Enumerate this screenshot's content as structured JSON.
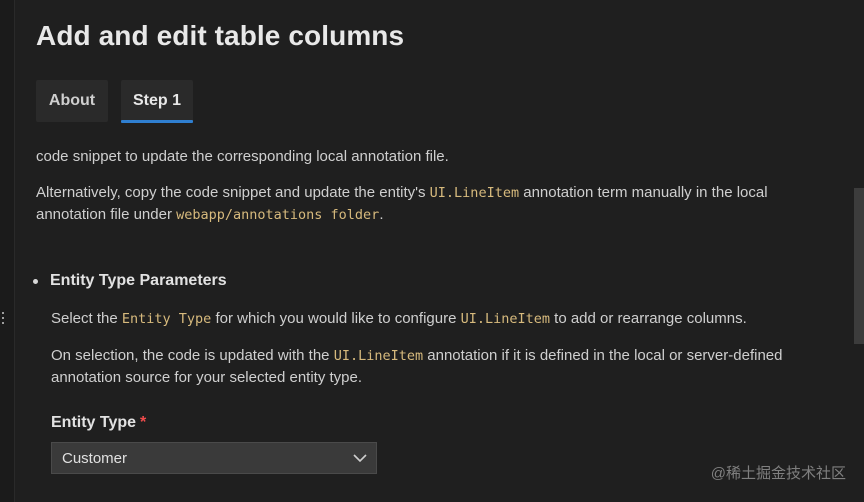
{
  "page": {
    "title": "Add and edit table columns"
  },
  "tabs": [
    {
      "label": "About",
      "active": false
    },
    {
      "label": "Step 1",
      "active": true
    }
  ],
  "content": {
    "intro_text": "code snippet to update the corresponding local annotation file.",
    "alt_text_1": "Alternatively, copy the code snippet and update the entity's ",
    "alt_code_1": "UI.LineItem",
    "alt_text_2": " annotation term manually in the local annotation file under ",
    "alt_code_2": "webapp/annotations folder",
    "alt_text_3": ".",
    "section": {
      "heading": "Entity Type Parameters",
      "p1_text_1": "Select the ",
      "p1_code_1": "Entity Type",
      "p1_text_2": " for which you would like to configure ",
      "p1_code_2": "UI.LineItem",
      "p1_text_3": " to add or rearrange columns.",
      "p2_text_1": "On selection, the code is updated with the ",
      "p2_code_1": "UI.LineItem",
      "p2_text_2": " annotation if it is defined in the local or server-defined annotation source for your selected entity type."
    },
    "field": {
      "label": "Entity Type",
      "required_marker": "*",
      "selected_value": "Customer"
    }
  },
  "watermark": "@稀土掘金技术社区",
  "colors": {
    "background": "#1f1f1f",
    "code_text": "#d7ba7d",
    "tab_underline": "#2f7fd0",
    "required": "#f14c4c"
  },
  "icons": {
    "select_arrow": "chevron-down-icon",
    "sash": "more-vertical-icon"
  }
}
